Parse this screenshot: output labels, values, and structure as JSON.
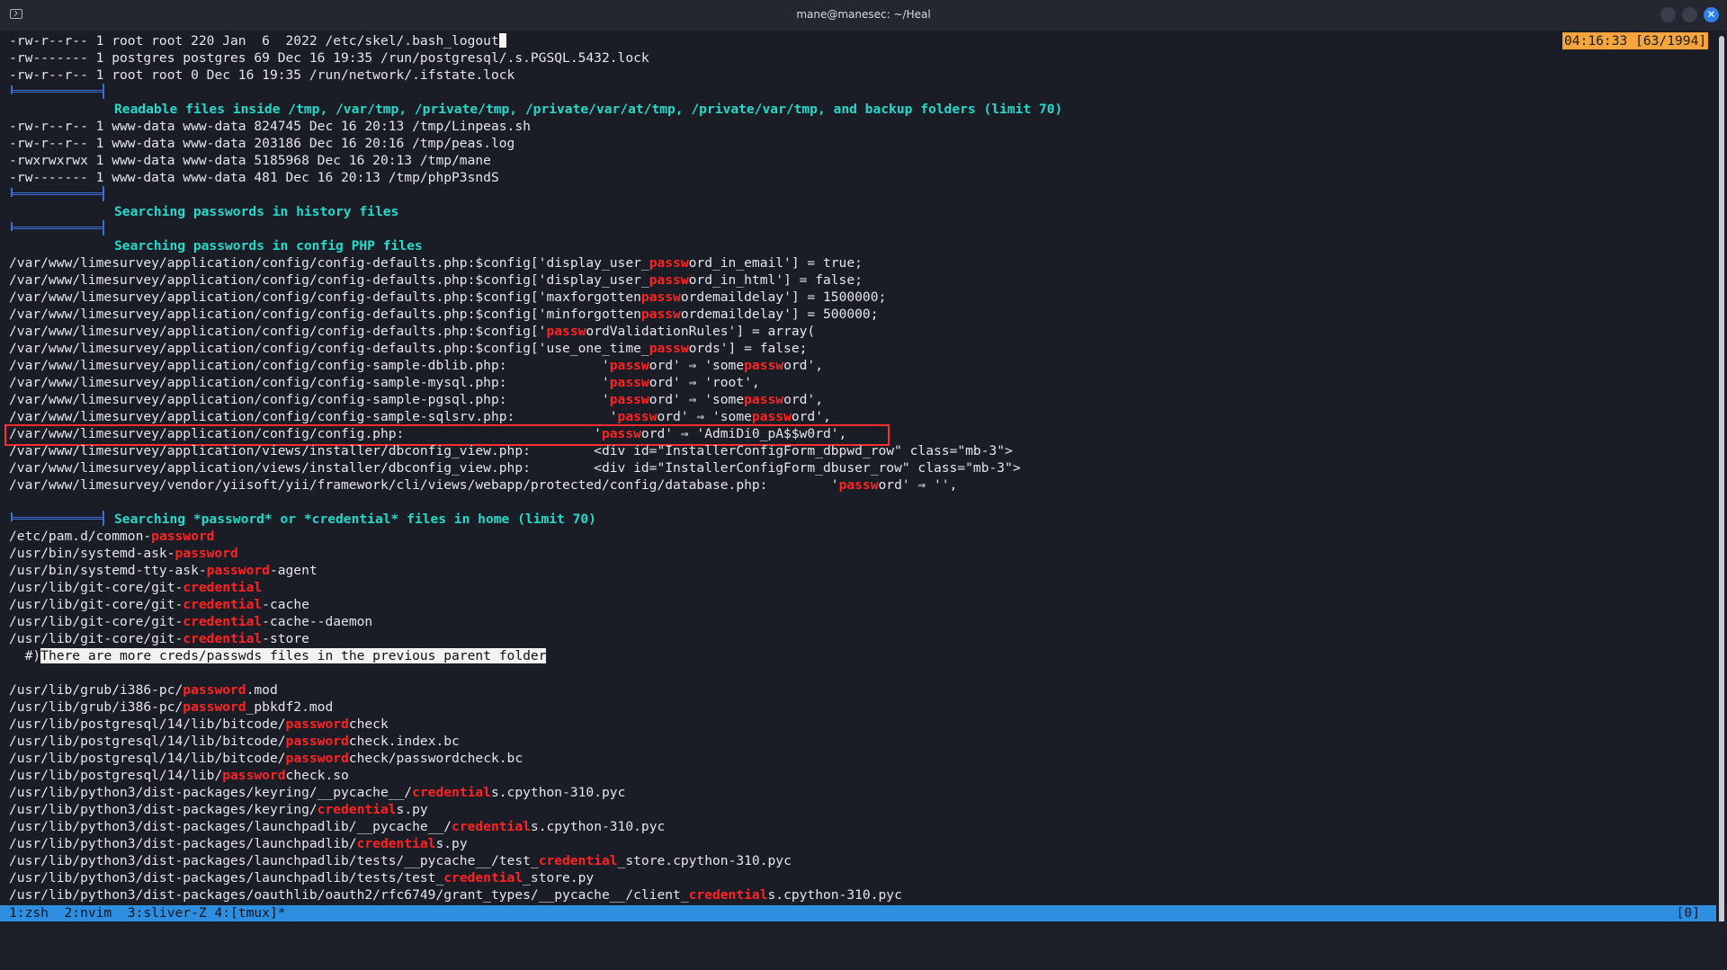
{
  "window": {
    "title": "mane@manesec: ~/Heal"
  },
  "clock": "04:16:33 [63/1994]",
  "lines": {
    "l1": "-rw-r--r-- 1 root root 220 Jan  6  2022 /etc/skel/.bash_logout",
    "l2": "-rw------- 1 postgres postgres 69 Dec 16 19:35 /run/postgresql/.s.PGSQL.5432.lock",
    "l3": "-rw-r--r-- 1 root root 0 Dec 16 19:35 /run/network/.ifstate.lock",
    "h1": "Readable files inside /tmp, /var/tmp, /private/tmp, /private/var/at/tmp, /private/var/tmp, and backup folders (limit 70)",
    "l5": "-rw-r--r-- 1 www-data www-data 824745 Dec 16 20:13 /tmp/Linpeas.sh",
    "l6": "-rw-r--r-- 1 www-data www-data 203186 Dec 16 20:16 /tmp/peas.log",
    "l7": "-rwxrwxrwx 1 www-data www-data 5185968 Dec 16 20:13 /tmp/mane",
    "l8": "-rw------- 1 www-data www-data 481 Dec 16 20:13 /tmp/phpP3sndS",
    "h2": "Searching passwords in history files",
    "h3": "Searching passwords in config PHP files",
    "c1": {
      "a": "/var/www/limesurvey/application/config/config-defaults.php:$config['display_user_",
      "r": "passw",
      "b": "ord_in_email'] = true;"
    },
    "c2": {
      "a": "/var/www/limesurvey/application/config/config-defaults.php:$config['display_user_",
      "r": "passw",
      "b": "ord_in_html'] = false;"
    },
    "c3": {
      "a": "/var/www/limesurvey/application/config/config-defaults.php:$config['maxforgotten",
      "r": "passw",
      "b": "ordemaildelay'] = 1500000;"
    },
    "c4": {
      "a": "/var/www/limesurvey/application/config/config-defaults.php:$config['minforgotten",
      "r": "passw",
      "b": "ordemaildelay'] = 500000;"
    },
    "c5": {
      "a": "/var/www/limesurvey/application/config/config-defaults.php:$config['",
      "r": "passw",
      "b": "ordValidationRules'] = array("
    },
    "c6": {
      "a": "/var/www/limesurvey/application/config/config-defaults.php:$config['use_one_time_",
      "r": "passw",
      "b": "ords'] = false;"
    },
    "c7": {
      "a": "/var/www/limesurvey/application/config/config-sample-dblib.php:            '",
      "r": "passw",
      "b": "ord' ⇒ 'some",
      "r2": "passw",
      "c": "ord',"
    },
    "c8": {
      "a": "/var/www/limesurvey/application/config/config-sample-mysql.php:            '",
      "r": "passw",
      "b": "ord' ⇒ 'root',"
    },
    "c9": {
      "a": "/var/www/limesurvey/application/config/config-sample-pgsql.php:            '",
      "r": "passw",
      "b": "ord' ⇒ 'some",
      "r2": "passw",
      "c": "ord',"
    },
    "c10": {
      "a": "/var/www/limesurvey/application/config/config-sample-sqlsrv.php:            '",
      "r": "passw",
      "b": "ord' ⇒ 'some",
      "r2": "passw",
      "c": "ord',"
    },
    "c11": {
      "a": "/var/www/limesurvey/application/config/config.php:                        '",
      "r": "passw",
      "b": "ord' ⇒ 'AdmiDi0_pA$$w0rd',"
    },
    "c12": "/var/www/limesurvey/application/views/installer/dbconfig_view.php:        <div id=\"InstallerConfigForm_dbpwd_row\" class=\"mb-3\">",
    "c13": "/var/www/limesurvey/application/views/installer/dbconfig_view.php:        <div id=\"InstallerConfigForm_dbuser_row\" class=\"mb-3\">",
    "c14": {
      "a": "/var/www/limesurvey/vendor/yiisoft/yii/framework/cli/views/webapp/protected/config/database.php:        '",
      "r": "passw",
      "b": "ord' ⇒ '',"
    },
    "h4": "Searching *password* or *credential* files in home (limit 70)",
    "f1": {
      "a": "/etc/pam.d/common-",
      "r": "password",
      "b": ""
    },
    "f2": {
      "a": "/usr/bin/systemd-ask-",
      "r": "password",
      "b": ""
    },
    "f3": {
      "a": "/usr/bin/systemd-tty-ask-",
      "r": "password",
      "b": "-agent"
    },
    "f4": {
      "a": "/usr/lib/git-core/git-",
      "r": "credential",
      "b": ""
    },
    "f5": {
      "a": "/usr/lib/git-core/git-",
      "r": "credential",
      "b": "-cache"
    },
    "f6": {
      "a": "/usr/lib/git-core/git-",
      "r": "credential",
      "b": "-cache--daemon"
    },
    "f7": {
      "a": "/usr/lib/git-core/git-",
      "r": "credential",
      "b": "-store"
    },
    "note_prefix": "  #)",
    "note": "There are more creds/passwds files in the previous parent folder",
    "g1": {
      "a": "/usr/lib/grub/i386-pc/",
      "r": "password",
      "b": ".mod"
    },
    "g2": {
      "a": "/usr/lib/grub/i386-pc/",
      "r": "password",
      "b": "_pbkdf2.mod"
    },
    "g3": {
      "a": "/usr/lib/postgresql/14/lib/bitcode/",
      "r": "password",
      "b": "check"
    },
    "g4": {
      "a": "/usr/lib/postgresql/14/lib/bitcode/",
      "r": "password",
      "b": "check.index.bc"
    },
    "g5": {
      "a": "/usr/lib/postgresql/14/lib/bitcode/",
      "r": "password",
      "b": "check/passwordcheck.bc"
    },
    "g6": {
      "a": "/usr/lib/postgresql/14/lib/",
      "r": "password",
      "b": "check.so"
    },
    "g7": {
      "a": "/usr/lib/python3/dist-packages/keyring/__pycache__/",
      "r": "credential",
      "b": "s.cpython-310.pyc"
    },
    "g8": {
      "a": "/usr/lib/python3/dist-packages/keyring/",
      "r": "credential",
      "b": "s.py"
    },
    "g9": {
      "a": "/usr/lib/python3/dist-packages/launchpadlib/__pycache__/",
      "r": "credential",
      "b": "s.cpython-310.pyc"
    },
    "g10": {
      "a": "/usr/lib/python3/dist-packages/launchpadlib/",
      "r": "credential",
      "b": "s.py"
    },
    "g11": {
      "a": "/usr/lib/python3/dist-packages/launchpadlib/tests/__pycache__/test_",
      "r": "credential",
      "b": "_store.cpython-310.pyc"
    },
    "g12": {
      "a": "/usr/lib/python3/dist-packages/launchpadlib/tests/test_",
      "r": "credential",
      "b": "_store.py"
    },
    "g13": {
      "a": "/usr/lib/python3/dist-packages/oauthlib/oauth2/rfc6749/grant_types/__pycache__/client_",
      "r": "credential",
      "b": "s.cpython-310.pyc"
    }
  },
  "tmux": {
    "tabs": "1:zsh  2:nvim  3:sliver-Z 4:[tmux]*",
    "right": "[0]"
  }
}
